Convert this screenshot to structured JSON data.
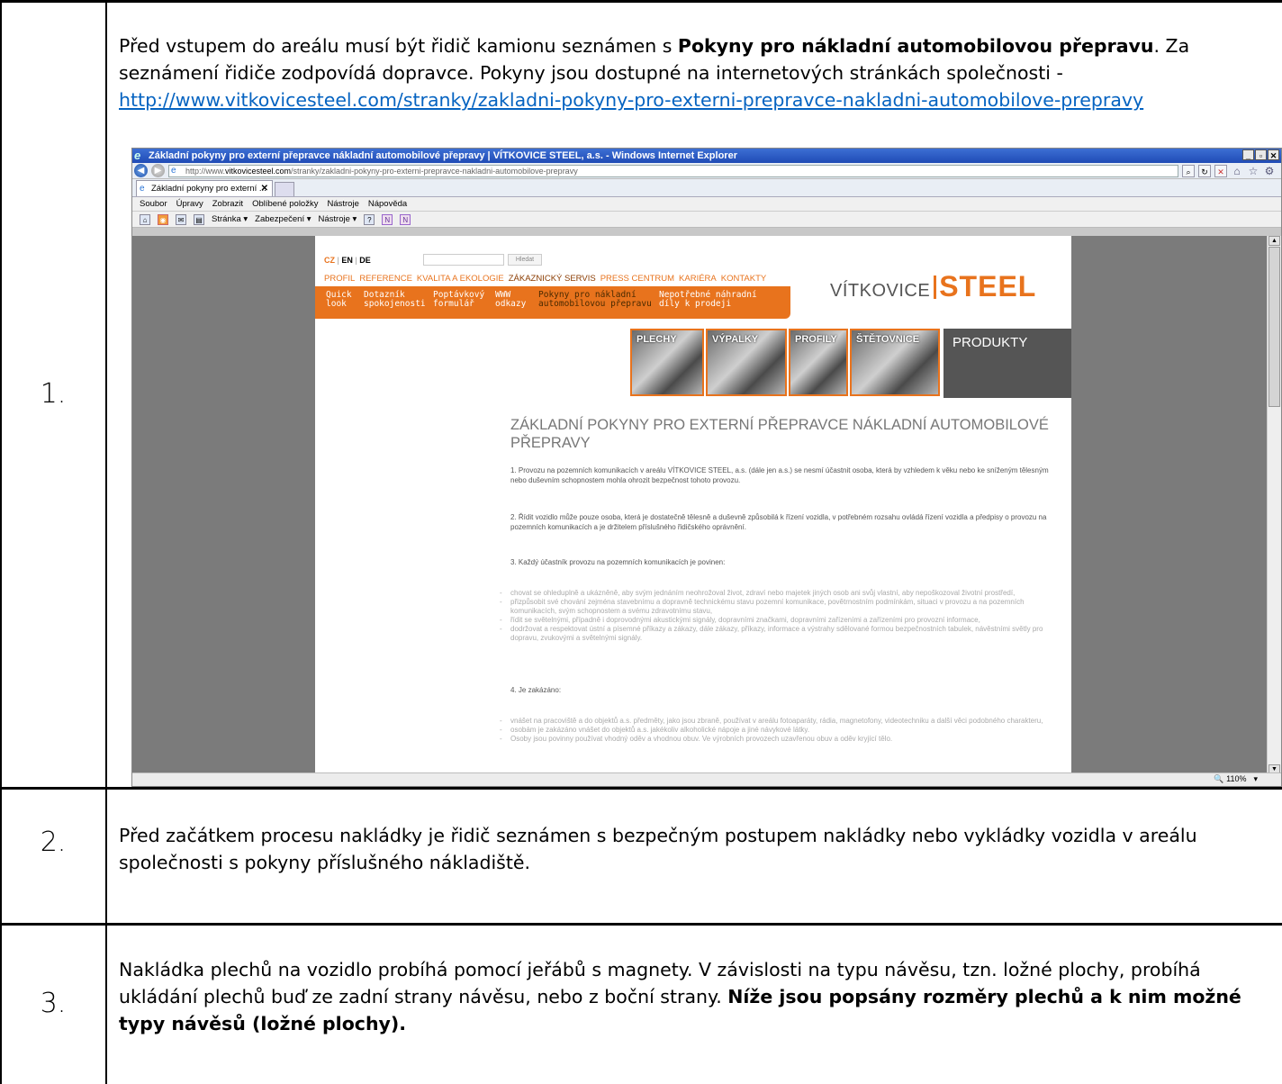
{
  "rows": [
    {
      "number": "1.",
      "text_before": "Před vstupem do areálu musí být řidič kamionu seznámen s ",
      "text_bold": "Pokyny pro nákladní automobilovou přepravu",
      "text_after": ". Za seznámení řidiče zodpovídá dopravce. Pokyny jsou dostupné na internetových stránkách společnosti - ",
      "link": "http://www.vitkovicesteel.com/stranky/zakladni-pokyny-pro-externi-prepravce-nakladni-automobilove-prepravy"
    },
    {
      "number": "2.",
      "text": "Před začátkem procesu nakládky je řidič seznámen s bezpečným postupem nakládky nebo vykládky vozidla v areálu společnosti s pokyny příslušného nákladiště."
    },
    {
      "number": "3.",
      "text": "Nakládka plechů na vozidlo probíhá pomocí jeřábů s magnety. V závislosti na typu návěsu, tzn. ložné plochy, probíhá ukládání plechů buď ze zadní strany návěsu, nebo z boční strany. ",
      "text_bold": "Níže jsou popsány rozměry plechů a k nim možné typy návěsů (ložné plochy)."
    }
  ],
  "browser": {
    "title": "Základní pokyny pro externí přepravce nákladní automobilové přepravy | VÍTKOVICE STEEL, a.s. - Windows Internet Explorer",
    "url_prefix": "http://www.",
    "url_domain": "vitkovicesteel.com",
    "url_path": "/stranky/zakladni-pokyny-pro-externi-prepravce-nakladni-automobilove-prepravy",
    "tab_label": "Základní pokyny pro externí ...",
    "menu": [
      "Soubor",
      "Úpravy",
      "Zobrazit",
      "Oblíbené položky",
      "Nástroje",
      "Nápověda"
    ],
    "cmd": {
      "page": "Stránka ▾",
      "security": "Zabezpečení ▾",
      "tools": "Nástroje ▾"
    },
    "zoom": "110%"
  },
  "site": {
    "lang": {
      "cz": "CZ",
      "sep": "|",
      "en": "EN",
      "de": "DE"
    },
    "search_button": "Hledat",
    "topnav": [
      "PROFIL",
      "REFERENCE",
      "KVALITA A EKOLOGIE",
      "ZÁKAZNICKÝ SERVIS",
      "PRESS CENTRUM",
      "KARIÉRA",
      "KONTAKTY"
    ],
    "subnav": [
      {
        "line1": "Quick",
        "line2": "look"
      },
      {
        "line1": "Dotazník",
        "line2": "spokojenosti"
      },
      {
        "line1": "Poptávkový",
        "line2": "formulář"
      },
      {
        "line1": "WWW",
        "line2": "odkazy"
      },
      {
        "line1": "Pokyny pro nákladní",
        "line2": "automobilovou přepravu"
      },
      {
        "line1": "Nepotřebné náhradní",
        "line2": "díly k prodeji"
      }
    ],
    "logo_left": "VÍTKOVICE",
    "logo_right": "STEEL",
    "products": [
      "PLECHY",
      "VÝPALKY",
      "PROFILY",
      "ŠTĚTOVNICE"
    ],
    "products_title": "PRODUKTY",
    "heading": "ZÁKLADNÍ POKYNY PRO EXTERNÍ PŘEPRAVCE NÁKLADNÍ AUTOMOBILOVÉ PŘEPRAVY",
    "p1": "1. Provozu na pozemních komunikacích v areálu VÍTKOVICE STEEL, a.s. (dále jen a.s.) se nesmí účastnit osoba, která by vzhledem k věku nebo ke sníženým tělesným nebo duševním schopnostem mohla ohrozit bezpečnost tohoto provozu.",
    "p2": "2. Řídit vozidlo může pouze osoba, která je dostatečně tělesně a duševně způsobilá k řízení vozidla, v potřebném rozsahu ovládá řízení vozidla a předpisy o provozu na pozemních komunikacích a je držitelem příslušného řidičského oprávnění.",
    "p3": "3. Každý účastník provozu na pozemních komunikacích je povinen:",
    "bullets3": [
      "chovat se ohleduplně a ukázněně, aby svým jednáním neohrožoval život, zdraví nebo majetek jiných osob ani svůj vlastní, aby nepoškozoval životní prostředí,",
      "přizpůsobit své chování zejména stavebnímu a dopravně technickému stavu pozemní komunikace, povětrnostním podmínkám, situaci v provozu a na pozemních komunikacích, svým schopnostem a svému zdravotnímu stavu,",
      "řídit se světelnými, případně i doprovodnými akustickými signály, dopravními značkami, dopravními zařízeními a zařízeními pro provozní informace,",
      "dodržovat a respektovat ústní a písemné příkazy a zákazy, dále zákazy, příkazy, informace a výstrahy sdělované formou bezpečnostních tabulek, návěstními světly pro dopravu, zvukovými a světelnými signály."
    ],
    "p4": "4. Je zakázáno:",
    "bullets4": [
      "vnášet na pracoviště a do objektů a.s. předměty, jako jsou zbraně, používat v areálu fotoaparáty, rádia, magnetofony, videotechniku a další věci podobného charakteru,",
      "osobám je zakázáno vnášet do objektů a.s. jakékoliv alkoholické nápoje a jiné návykové látky.",
      "Osoby jsou povinny používat vhodný oděv a vhodnou obuv. Ve výrobních provozech uzavřenou obuv a oděv kryjící tělo."
    ]
  }
}
